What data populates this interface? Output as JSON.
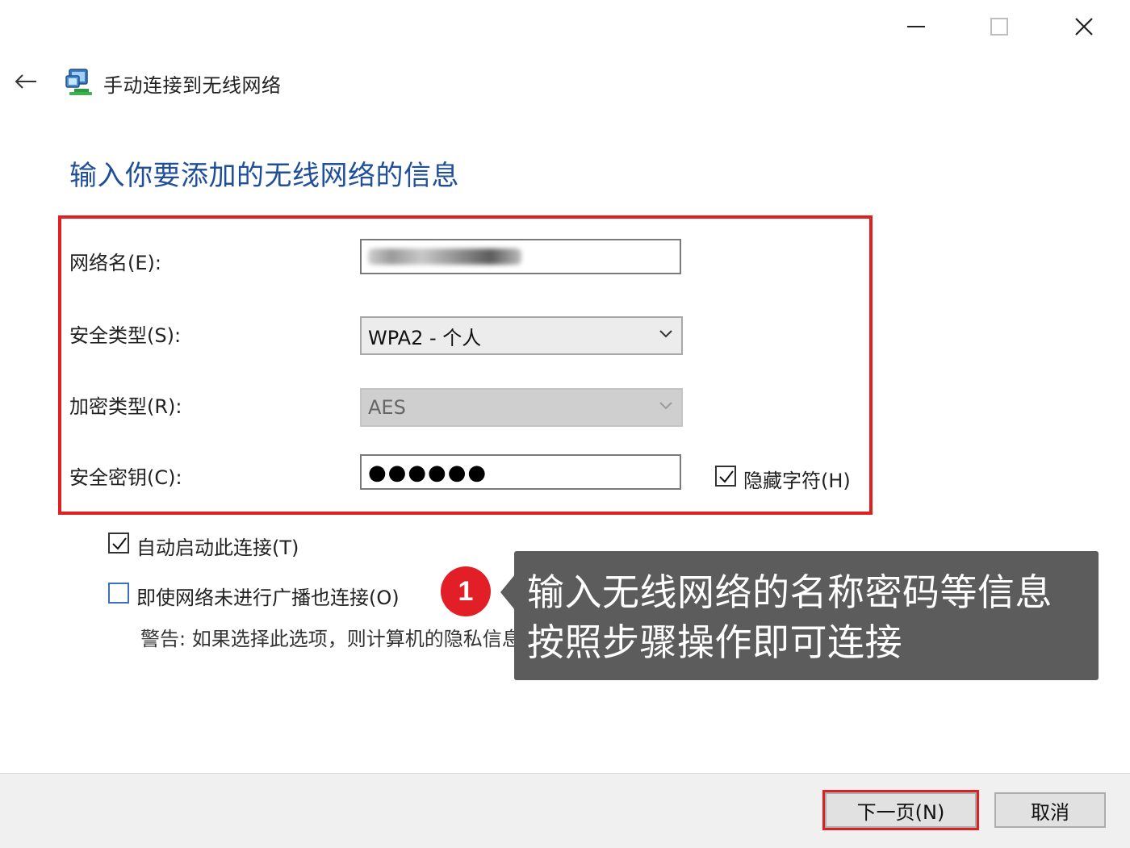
{
  "window": {
    "controls": {
      "minimize_icon": "minimize-icon",
      "maximize_icon": "maximize-icon",
      "close_icon": "close-icon"
    }
  },
  "header": {
    "back_icon": "back-arrow-icon",
    "app_icon": "network-computer-icon",
    "title": "手动连接到无线网络"
  },
  "main": {
    "heading": "输入你要添加的无线网络的信息",
    "highlight_color": "#e02020",
    "fields": {
      "network_name": {
        "label": "网络名(E):",
        "value": ""
      },
      "security_type": {
        "label": "安全类型(S):",
        "value": "WPA2 - 个人"
      },
      "encryption_type": {
        "label": "加密类型(R):",
        "value": "AES"
      },
      "security_key": {
        "label": "安全密钥(C):",
        "value": "●●●●●●"
      }
    },
    "hide_chars": {
      "label": "隐藏字符(H)",
      "checked": true
    },
    "auto_connect": {
      "label": "自动启动此连接(T)",
      "checked": true
    },
    "connect_hidden": {
      "label": "即使网络未进行广播也连接(O)",
      "checked": false
    },
    "warning": "警告: 如果选择此选项，则计算机的隐私信息可能存在风险。"
  },
  "overlay": {
    "badge": "1",
    "badge_color": "#e21f26",
    "line1": "输入无线网络的名称密码等信息",
    "line2": "按照步骤操作即可连接",
    "background": "#5c5c5c"
  },
  "footer": {
    "next_label": "下一页(N)",
    "cancel_label": "取消"
  }
}
